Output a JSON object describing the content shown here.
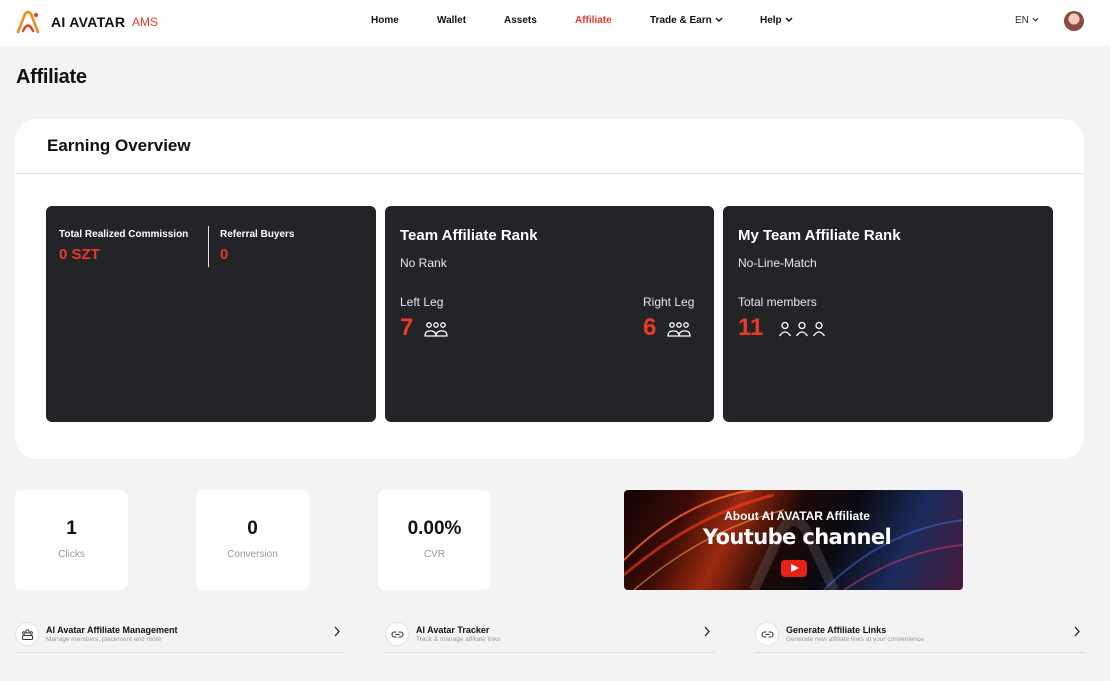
{
  "header": {
    "brand": "AI AVATAR",
    "brand_sub": "AMS",
    "nav": {
      "home": "Home",
      "wallet": "Wallet",
      "assets": "Assets",
      "affiliate": "Affiliate",
      "trade_earn": "Trade & Earn",
      "help": "Help"
    },
    "language": "EN"
  },
  "page_title": "Affiliate",
  "overview": {
    "title": "Earning Overview",
    "commission": {
      "label": "Total Realized Commission",
      "value": "0 SZT"
    },
    "referral": {
      "label": "Referral Buyers",
      "value": "0"
    },
    "team_rank": {
      "title": "Team Affiliate Rank",
      "rank": "No Rank",
      "left_label": "Left Leg",
      "left_value": "7",
      "right_label": "Right Leg",
      "right_value": "6"
    },
    "my_team_rank": {
      "title": "My Team Affiliate Rank",
      "status": "No-Line-Match",
      "members_label": "Total members",
      "members_value": "11"
    }
  },
  "stats": {
    "clicks": {
      "value": "1",
      "label": "Clicks"
    },
    "conversion": {
      "value": "0",
      "label": "Conversion"
    },
    "cvr": {
      "value": "0.00%",
      "label": "CVR"
    }
  },
  "banner": {
    "line1": "About AI AVATAR Affiliate",
    "line2": "Youtube channel"
  },
  "links": {
    "management": {
      "title": "AI Avatar Affiliate Management",
      "subtitle": "Manage members, placement and more"
    },
    "tracker": {
      "title": "AI Avatar Tracker",
      "subtitle": "Track & manage affiliate links"
    },
    "generate": {
      "title": "Generate Affiliate Links",
      "subtitle": "Generate new affiliate links at your convenience"
    }
  },
  "colors": {
    "accent": "#ec3a26",
    "card_bg": "#232428",
    "page_bg": "#f3f3f3"
  }
}
